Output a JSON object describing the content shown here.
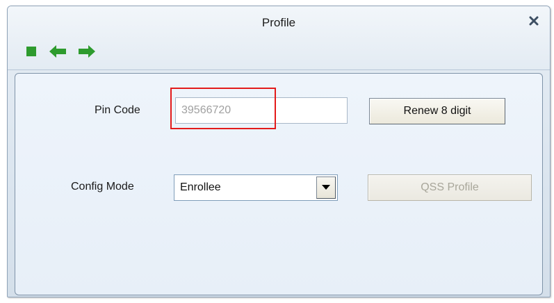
{
  "window": {
    "title": "Profile"
  },
  "icons": {
    "close": "close-icon",
    "stop": "stop-icon",
    "back": "back-arrow-icon",
    "forward": "forward-arrow-icon"
  },
  "form": {
    "pin_label": "Pin Code",
    "pin_value": "39566720",
    "renew_label": "Renew 8 digit",
    "config_label": "Config Mode",
    "config_value": "Enrollee",
    "qss_label": "QSS Profile"
  },
  "colors": {
    "icon_green": "#2e9b2e",
    "highlight_red": "#e31a1a"
  }
}
